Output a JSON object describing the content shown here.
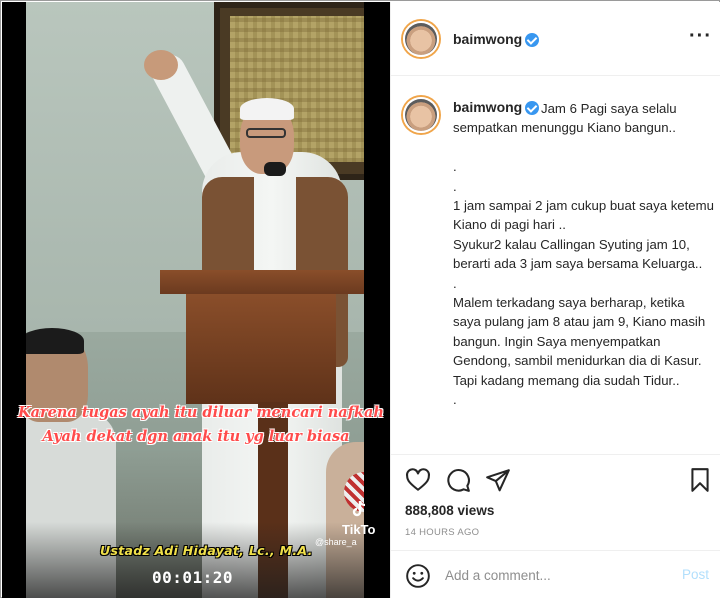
{
  "video": {
    "subtitle_line1": "Karena tugas ayah itu diluar mencari nafkah",
    "subtitle_line2": "Ayah dekat dgn anak itu yg luar biasa",
    "speaker": "Ustadz Adi Hidayat, Lc., M.A.",
    "timer": "00:01:20",
    "tiktok_label": "TikTo",
    "tiktok_user": "@share_a"
  },
  "post": {
    "username": "baimwong",
    "verified": true,
    "caption_first": "Jam 6 Pagi saya selalu sempatkan menunggu Kiano bangun..",
    "caption_lines": [
      " ",
      ".",
      ".",
      "1 jam sampai 2 jam cukup buat saya ketemu Kiano di pagi hari ..",
      "Syukur2 kalau Callingan Syuting jam 10, berarti ada 3 jam saya bersama Keluarga..",
      ".",
      "Malem terkadang saya berharap, ketika saya pulang jam 8 atau jam 9, Kiano masih bangun. Ingin Saya menyempatkan Gendong, sambil menidurkan dia di Kasur.",
      "Tapi kadang memang dia sudah Tidur..",
      "."
    ],
    "views": "888,808 views",
    "time": "14 HOURS AGO"
  },
  "comment": {
    "placeholder": "Add a comment...",
    "post_label": "Post"
  },
  "colors": {
    "verified": "#3897f0",
    "post_disabled": "#b2dffc",
    "subtitle": "#ff4b4b",
    "speaker": "#f0e04a"
  },
  "icons": {
    "like": "heart-icon",
    "comment": "comment-icon",
    "share": "paper-plane-icon",
    "save": "bookmark-icon",
    "more": "more-options-icon",
    "emoji": "emoji-icon"
  }
}
